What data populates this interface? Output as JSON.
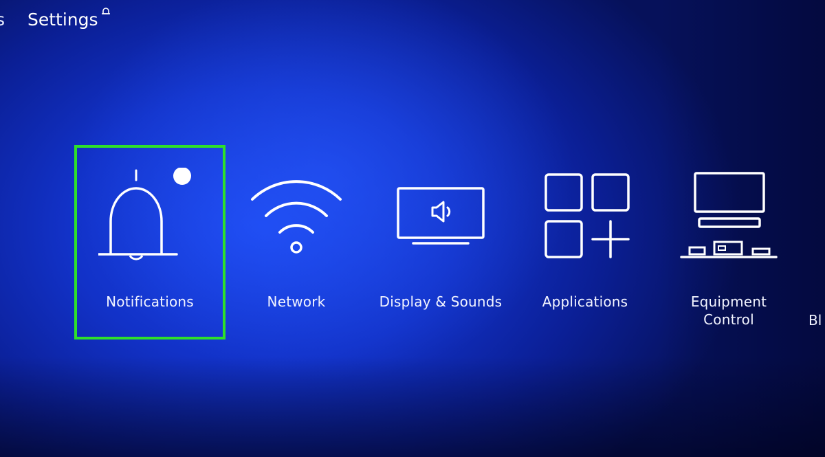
{
  "nav": {
    "prev_label": "s",
    "current_label": "Settings"
  },
  "tiles": [
    {
      "label": "Notifications",
      "icon": "bell-icon",
      "focused": true
    },
    {
      "label": "Network",
      "icon": "wifi-icon"
    },
    {
      "label": "Display & Sounds",
      "icon": "display-speaker-icon"
    },
    {
      "label": "Applications",
      "icon": "apps-grid-icon"
    },
    {
      "label_line1": "Equipment",
      "label_line2": "Control",
      "icon": "equipment-control-icon"
    }
  ],
  "partial_tile_label": "Bl",
  "colors": {
    "focus_border": "#2ee02a",
    "background": "#1232c8",
    "foreground": "#ffffff"
  }
}
